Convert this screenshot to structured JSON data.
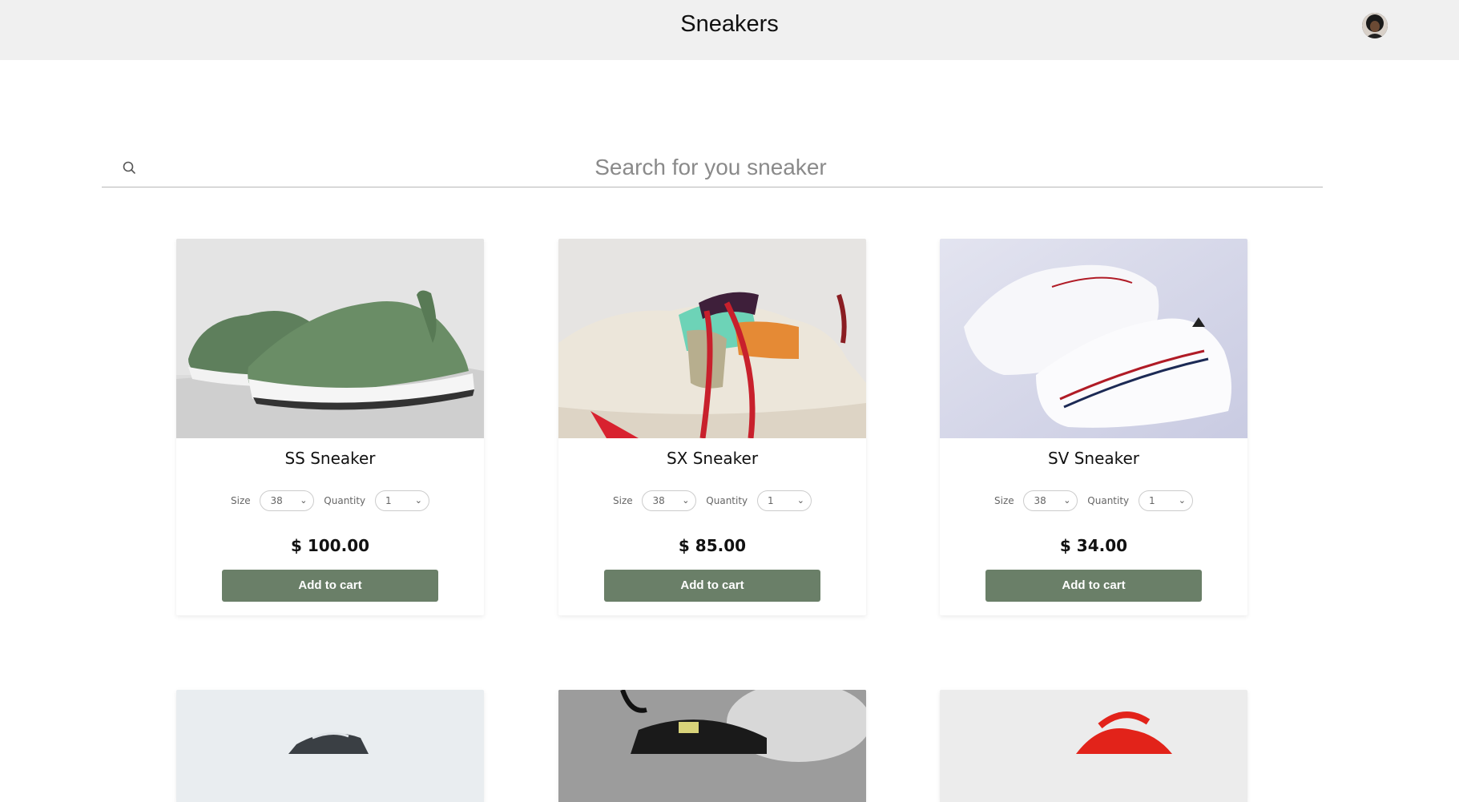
{
  "header": {
    "title": "Sneakers",
    "avatar_icon": "user-avatar"
  },
  "search": {
    "placeholder": "Search for you sneaker",
    "icon": "search-icon"
  },
  "labels": {
    "size": "Size",
    "quantity": "Quantity",
    "add_to_cart": "Add to cart"
  },
  "products": [
    {
      "name": "SS Sneaker",
      "size": "38",
      "quantity": "1",
      "price": "$ 100.00"
    },
    {
      "name": "SX Sneaker",
      "size": "38",
      "quantity": "1",
      "price": "$ 85.00"
    },
    {
      "name": "SV Sneaker",
      "size": "38",
      "quantity": "1",
      "price": "$ 34.00"
    }
  ],
  "colors": {
    "button": "#6a7f68",
    "header_bg": "#f0f0f0"
  }
}
